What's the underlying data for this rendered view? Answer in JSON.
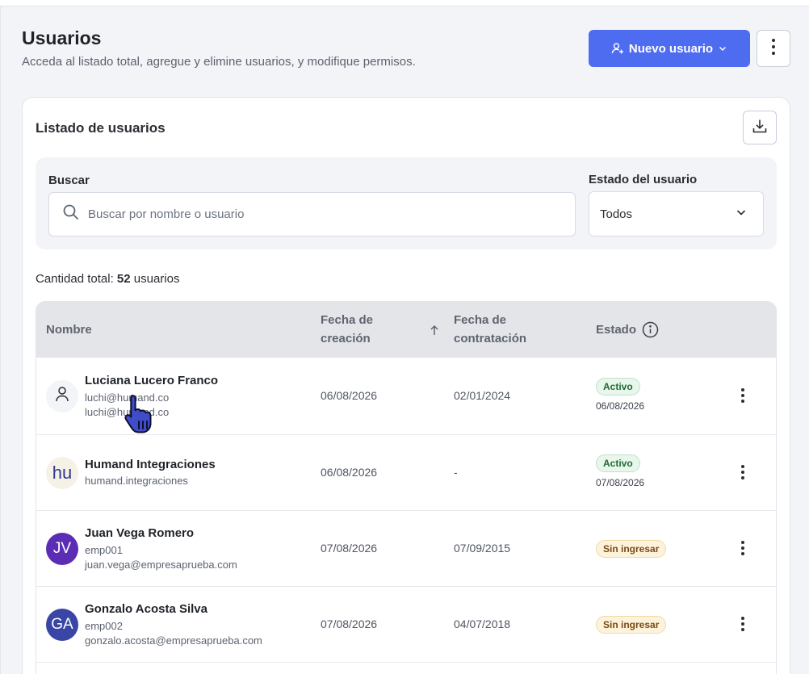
{
  "header": {
    "title": "Usuarios",
    "subtitle": "Acceda al listado total, agregue y elimine usuarios, y modifique permisos.",
    "new_user_label": "Nuevo usuario",
    "accent_color": "#4e6cf0"
  },
  "card": {
    "title": "Listado de usuarios"
  },
  "filters": {
    "search_label": "Buscar",
    "search_placeholder": "Buscar por nombre o usuario",
    "search_value": "",
    "status_label": "Estado del usuario",
    "status_value": "Todos"
  },
  "total": {
    "prefix": "Cantidad total:",
    "count": "52",
    "suffix": "usuarios"
  },
  "table": {
    "columns": {
      "name": "Nombre",
      "created_line1": "Fecha de",
      "created_line2": "creación",
      "hired_line1": "Fecha de",
      "hired_line2": "contratación",
      "status": "Estado"
    },
    "rows": [
      {
        "avatar_text": "",
        "avatar_kind": "person-icon",
        "name": "Luciana Lucero Franco",
        "line1": "luchi@humand.co",
        "line2": "luchi@humand.co",
        "created": "06/08/2026",
        "hired": "02/01/2024",
        "status": "Activo",
        "status_date": "06/08/2026"
      },
      {
        "avatar_text": "hu",
        "avatar_kind": "logo",
        "name": "Humand Integraciones",
        "line1": "humand.integraciones",
        "line2": "",
        "created": "06/08/2026",
        "hired": "-",
        "status": "Activo",
        "status_date": "07/08/2026"
      },
      {
        "avatar_text": "JV",
        "avatar_kind": "initials",
        "avatar_color": "#5b2db5",
        "name": "Juan Vega Romero",
        "line1": "emp001",
        "line2": "juan.vega@empresaprueba.com",
        "created": "07/08/2026",
        "hired": "07/09/2015",
        "status": "Sin ingresar",
        "status_date": ""
      },
      {
        "avatar_text": "GA",
        "avatar_kind": "initials",
        "avatar_color": "#3a46a6",
        "name": "Gonzalo Acosta Silva",
        "line1": "emp002",
        "line2": "gonzalo.acosta@empresaprueba.com",
        "created": "07/08/2026",
        "hired": "04/07/2018",
        "status": "Sin ingresar",
        "status_date": ""
      }
    ]
  }
}
